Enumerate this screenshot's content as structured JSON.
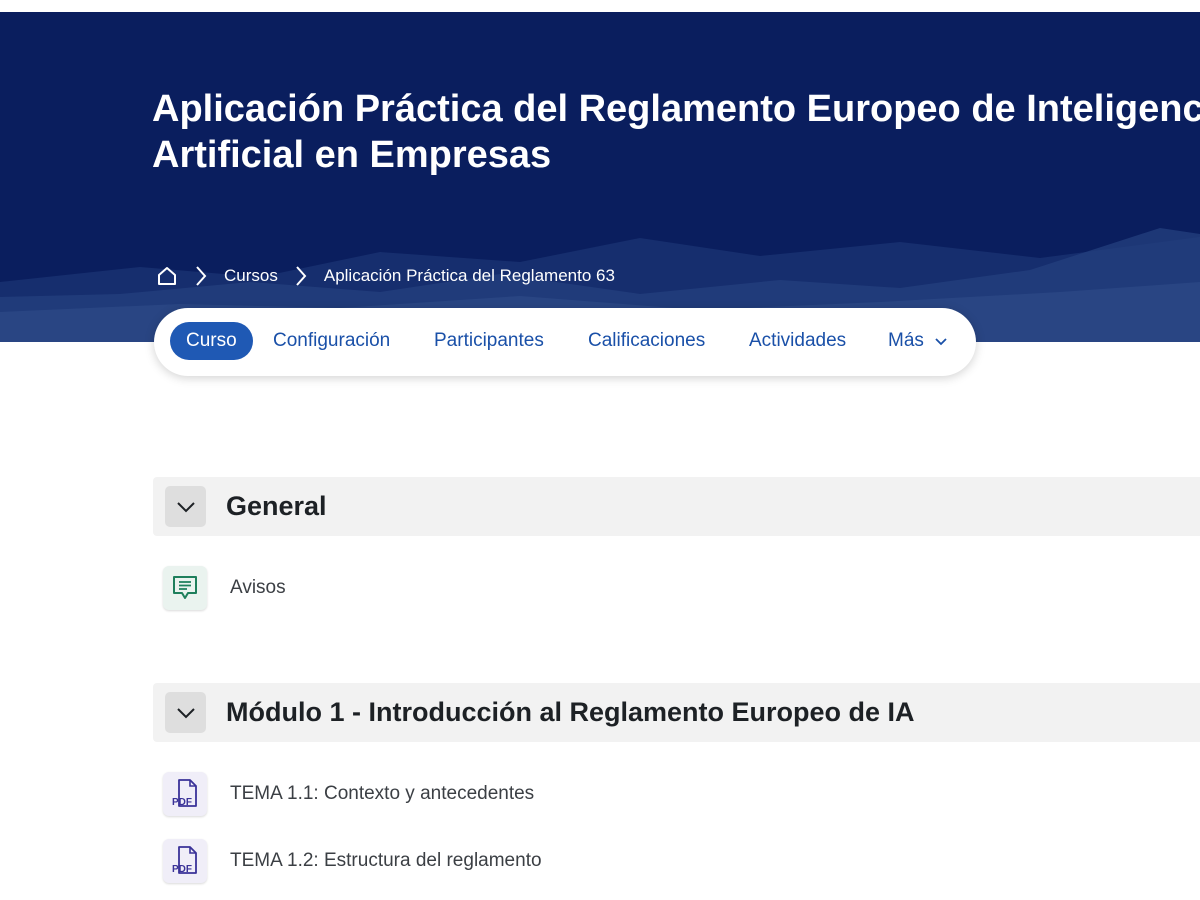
{
  "course": {
    "title_line1": "Aplicación Práctica del Reglamento Europeo de Inteligencia",
    "title_line2": "Artificial en Empresas"
  },
  "breadcrumb": {
    "home_icon": "home-icon",
    "items": [
      "Cursos",
      "Aplicación Práctica del Reglamento 63"
    ]
  },
  "nav": {
    "tabs": [
      "Curso",
      "Configuración",
      "Participantes",
      "Calificaciones",
      "Actividades",
      "Más"
    ],
    "active_tab": "Curso"
  },
  "sections": [
    {
      "title": "General",
      "activities": [
        {
          "label": "Avisos",
          "icon": "forum-icon"
        }
      ]
    },
    {
      "title": "Módulo 1 - Introducción al Reglamento Europeo de IA",
      "activities": [
        {
          "label": "TEMA 1.1: Contexto y antecedentes",
          "icon": "pdf-icon",
          "icon_text": "PDF"
        },
        {
          "label": "TEMA 1.2: Estructura del reglamento",
          "icon": "pdf-icon",
          "icon_text": "PDF"
        }
      ]
    }
  ],
  "colors": {
    "banner": "#0a1e5e",
    "accent": "#1f59b4",
    "link": "#1a50a8",
    "section_bg": "#f2f2f2",
    "forum_icon": "#1e7f5c",
    "pdf_icon": "#3a3298"
  }
}
